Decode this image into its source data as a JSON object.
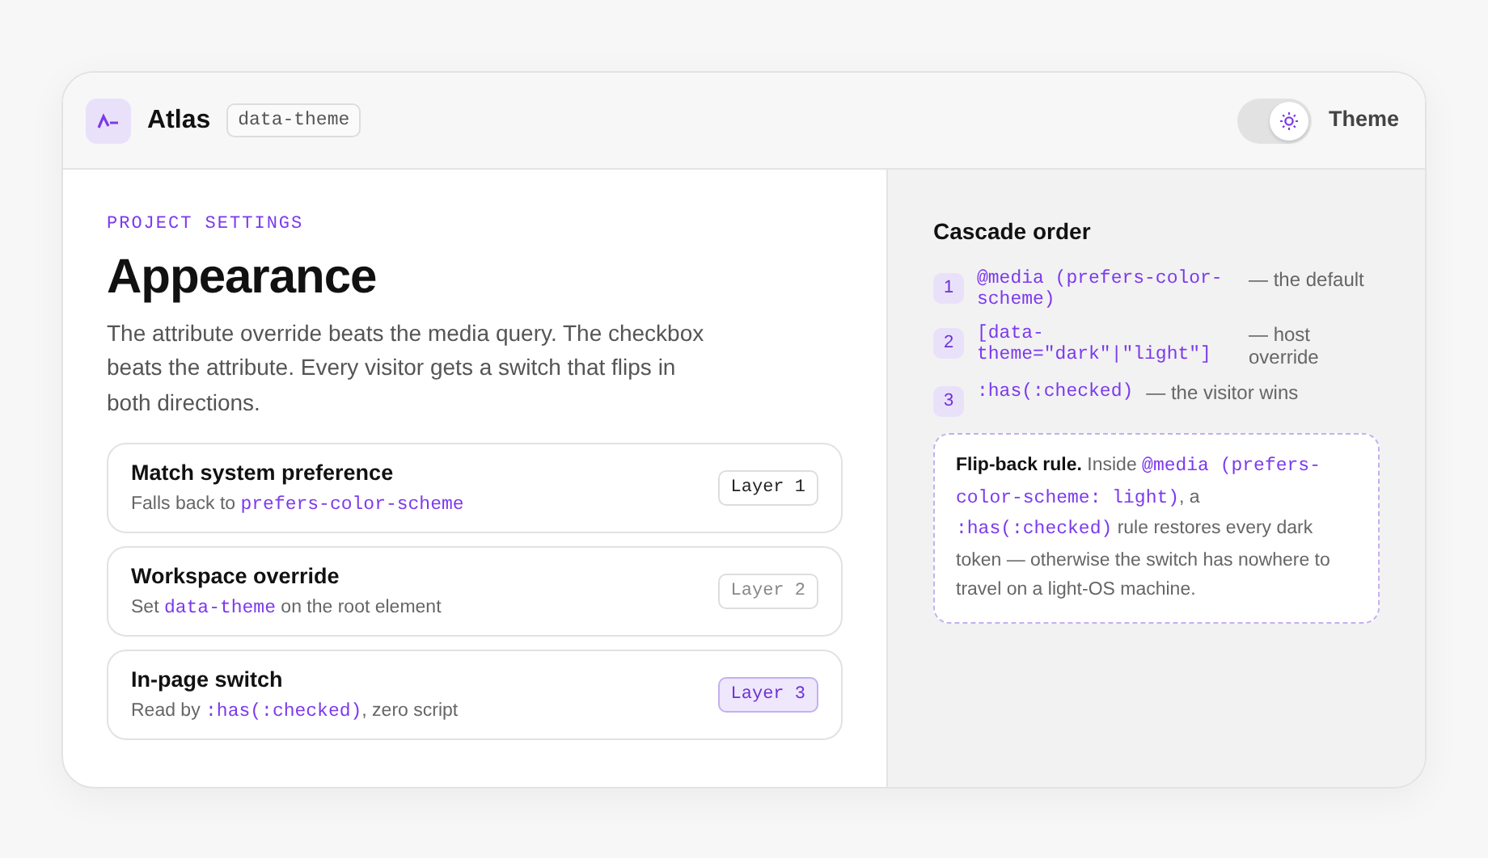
{
  "header": {
    "app_name": "Atlas",
    "tag": "data-theme",
    "theme_toggle": {
      "label": "Theme",
      "checked": true
    }
  },
  "main": {
    "eyebrow": "PROJECT SETTINGS",
    "title": "Appearance",
    "description": "The attribute override beats the media query. The checkbox beats the attribute. Every visitor gets a switch that flips in both directions.",
    "options": [
      {
        "title": "Match system preference",
        "subtitle": [
          {
            "kind": "text",
            "text": "Falls back to "
          },
          {
            "kind": "code",
            "text": "prefers-color-scheme"
          }
        ],
        "layer": "Layer 1",
        "selected": false,
        "dimmed": false
      },
      {
        "title": "Workspace override",
        "subtitle": [
          {
            "kind": "text",
            "text": "Set "
          },
          {
            "kind": "code",
            "text": "data-theme"
          },
          {
            "kind": "text",
            "text": " on the root element"
          }
        ],
        "layer": "Layer 2",
        "selected": false,
        "dimmed": true
      },
      {
        "title": "In-page switch",
        "subtitle": [
          {
            "kind": "text",
            "text": "Read by "
          },
          {
            "kind": "code",
            "text": ":has(:checked)"
          },
          {
            "kind": "text",
            "text": ", zero script"
          }
        ],
        "layer": "Layer 3",
        "selected": true,
        "dimmed": false
      }
    ]
  },
  "aside": {
    "title": "Cascade order",
    "steps": [
      {
        "number": "1",
        "code": "@media (prefers-color-scheme)",
        "note": "— the default"
      },
      {
        "number": "2",
        "code": "[data-theme=\"dark\"|\"light\"]",
        "note": "— host override"
      },
      {
        "number": "3",
        "code": ":has(:checked)",
        "note": "— the visitor wins"
      }
    ],
    "callout": [
      {
        "kind": "bold",
        "text": "Flip-back rule."
      },
      {
        "kind": "text",
        "text": " Inside "
      },
      {
        "kind": "code",
        "text": "@media (prefers-color-scheme: light)"
      },
      {
        "kind": "text",
        "text": ", a "
      },
      {
        "kind": "code",
        "text": ":has(:checked)"
      },
      {
        "kind": "text",
        "text": " rule restores every dark token — otherwise the switch has nowhere to travel on a light-OS machine."
      }
    ]
  }
}
